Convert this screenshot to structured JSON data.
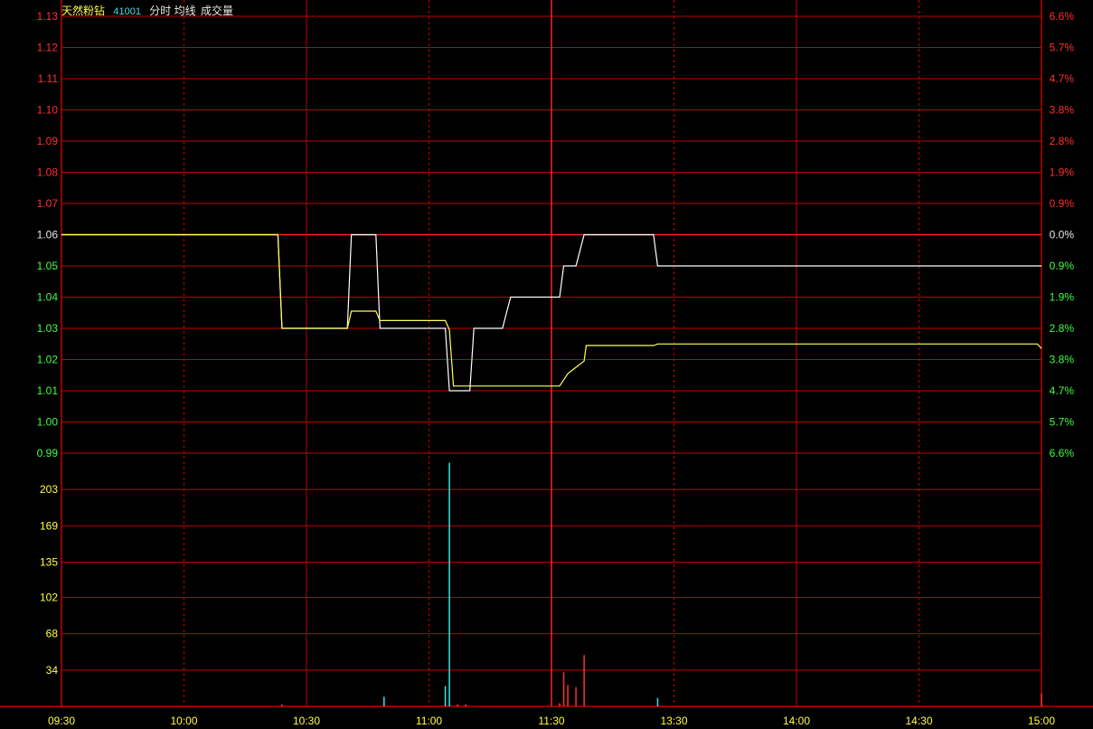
{
  "header": {
    "stock_name": "天然粉钻",
    "stock_code": "41001",
    "view": "分时",
    "avg_line_label": "均线",
    "volume_label": "成交量"
  },
  "colors": {
    "background": "#000000",
    "grid": "#c00000",
    "up": "#ff3030",
    "down": "#40ff40",
    "flat": "#e8e8e8",
    "price_line": "#ffffff",
    "avg_line": "#ffff60",
    "vol_label": "#ffff40",
    "time_label": "#ffff40",
    "vol_up": "#ff3030",
    "vol_down": "#40e0e0",
    "header_name": "#ffff40",
    "header_code": "#40e0e0",
    "header_text": "#e8e8e8"
  },
  "chart_data": {
    "type": "line",
    "price_axis": {
      "ylim": [
        0.99,
        1.13
      ],
      "ticks": [
        "1.13",
        "1.12",
        "1.11",
        "1.10",
        "1.09",
        "1.08",
        "1.07",
        "1.06",
        "1.05",
        "1.04",
        "1.03",
        "1.02",
        "1.01",
        "1.00",
        "0.99"
      ],
      "pct_ticks": [
        "6.6%",
        "5.7%",
        "4.7%",
        "3.8%",
        "2.8%",
        "1.9%",
        "0.9%",
        "0.0%",
        "0.9%",
        "1.9%",
        "2.8%",
        "3.8%",
        "4.7%",
        "5.7%",
        "6.6%"
      ],
      "prev_close": 1.06
    },
    "x": {
      "range_minutes": [
        0,
        240
      ],
      "tick_labels": [
        "09:30",
        "10:00",
        "10:30",
        "11:00",
        "11:30",
        "13:30",
        "14:00",
        "14:30",
        "15:00"
      ]
    },
    "series": [
      {
        "name": "分时",
        "points": [
          [
            0,
            1.06
          ],
          [
            53,
            1.06
          ],
          [
            54,
            1.03
          ],
          [
            70,
            1.03
          ],
          [
            71,
            1.06
          ],
          [
            77,
            1.06
          ],
          [
            78,
            1.03
          ],
          [
            94,
            1.03
          ],
          [
            95,
            1.01
          ],
          [
            100,
            1.01
          ],
          [
            101,
            1.03
          ],
          [
            108,
            1.03
          ],
          [
            110,
            1.04
          ],
          [
            122,
            1.04
          ],
          [
            123,
            1.05
          ],
          [
            126,
            1.05
          ],
          [
            128,
            1.06
          ],
          [
            145,
            1.06
          ],
          [
            146,
            1.05
          ],
          [
            240,
            1.05
          ]
        ]
      },
      {
        "name": "均线",
        "points": [
          [
            0,
            1.06
          ],
          [
            53,
            1.06
          ],
          [
            54,
            1.03
          ],
          [
            70,
            1.03
          ],
          [
            71,
            1.0355
          ],
          [
            77,
            1.0355
          ],
          [
            78,
            1.0325
          ],
          [
            94,
            1.0325
          ],
          [
            95,
            1.0295
          ],
          [
            96,
            1.0115
          ],
          [
            100,
            1.0115
          ],
          [
            101,
            1.0115
          ],
          [
            122,
            1.0115
          ],
          [
            124,
            1.0155
          ],
          [
            126,
            1.0175
          ],
          [
            128,
            1.0195
          ],
          [
            128.5,
            1.0245
          ],
          [
            145,
            1.0245
          ],
          [
            146,
            1.025
          ],
          [
            239,
            1.025
          ],
          [
            240,
            1.0235
          ]
        ]
      }
    ],
    "volume_axis": {
      "ylim": [
        0,
        237
      ],
      "ticks": [
        "203",
        "169",
        "135",
        "102",
        "68",
        "34"
      ]
    },
    "volume": [
      {
        "t": 54,
        "v": 2,
        "dir": "up"
      },
      {
        "t": 79,
        "v": 9,
        "dir": "down"
      },
      {
        "t": 94,
        "v": 19,
        "dir": "down"
      },
      {
        "t": 95,
        "v": 228,
        "dir": "down"
      },
      {
        "t": 97,
        "v": 2,
        "dir": "up"
      },
      {
        "t": 99,
        "v": 2,
        "dir": "up"
      },
      {
        "t": 122,
        "v": 3,
        "dir": "up"
      },
      {
        "t": 123,
        "v": 32,
        "dir": "up"
      },
      {
        "t": 124,
        "v": 20,
        "dir": "up"
      },
      {
        "t": 126,
        "v": 18,
        "dir": "up"
      },
      {
        "t": 128,
        "v": 48,
        "dir": "up"
      },
      {
        "t": 146,
        "v": 8,
        "dir": "down"
      },
      {
        "t": 240,
        "v": 12,
        "dir": "up"
      }
    ]
  }
}
